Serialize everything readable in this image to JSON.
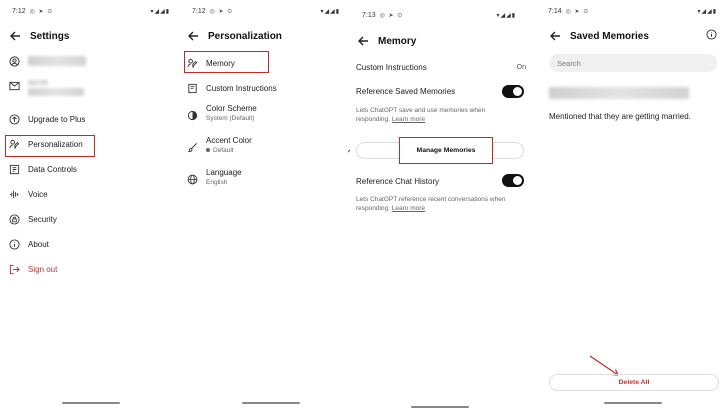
{
  "status": {
    "p1_time": "7:12",
    "p2_time": "7:12",
    "p3_time": "7:13",
    "p4_time": "7:14",
    "left_icons": "◎ ➤ ⊙",
    "right_icons": "▾◢◢▮"
  },
  "settings": {
    "title": "Settings",
    "items": [
      {
        "label": "Upgrade to Plus",
        "icon": "upgrade-icon"
      },
      {
        "label": "Personalization",
        "icon": "personalization-icon"
      },
      {
        "label": "Data Controls",
        "icon": "data-controls-icon"
      },
      {
        "label": "Voice",
        "icon": "voice-icon"
      },
      {
        "label": "Security",
        "icon": "security-icon"
      },
      {
        "label": "About",
        "icon": "about-icon"
      },
      {
        "label": "Sign out",
        "icon": "sign-out-icon"
      }
    ]
  },
  "personalization": {
    "title": "Personalization",
    "memory": "Memory",
    "custom_instructions": "Custom Instructions",
    "color_scheme": "Color Scheme",
    "color_scheme_value": "System (Default)",
    "accent_color": "Accent Color",
    "accent_color_value": "Default",
    "language": "Language",
    "language_value": "English"
  },
  "memory": {
    "title": "Memory",
    "custom_instructions": "Custom Instructions",
    "custom_instructions_value": "On",
    "reference_saved": "Reference Saved Memories",
    "reference_saved_on": true,
    "reference_saved_desc": "Lets ChatGPT save and use memories when responding.",
    "learn_more": "Learn more",
    "manage_memories": "Manage Memories",
    "reference_chat": "Reference Chat History",
    "reference_chat_on": true,
    "reference_chat_desc": "Lets ChatGPT reference recent conversations when responding."
  },
  "saved_memories": {
    "title": "Saved Memories",
    "search_placeholder": "Search",
    "memory_text": "Mentioned that they are getting married.",
    "delete_all": "Delete All"
  },
  "colors": {
    "highlight": "#c62828",
    "danger": "#d32f2f",
    "toggle_on": "#111111"
  }
}
